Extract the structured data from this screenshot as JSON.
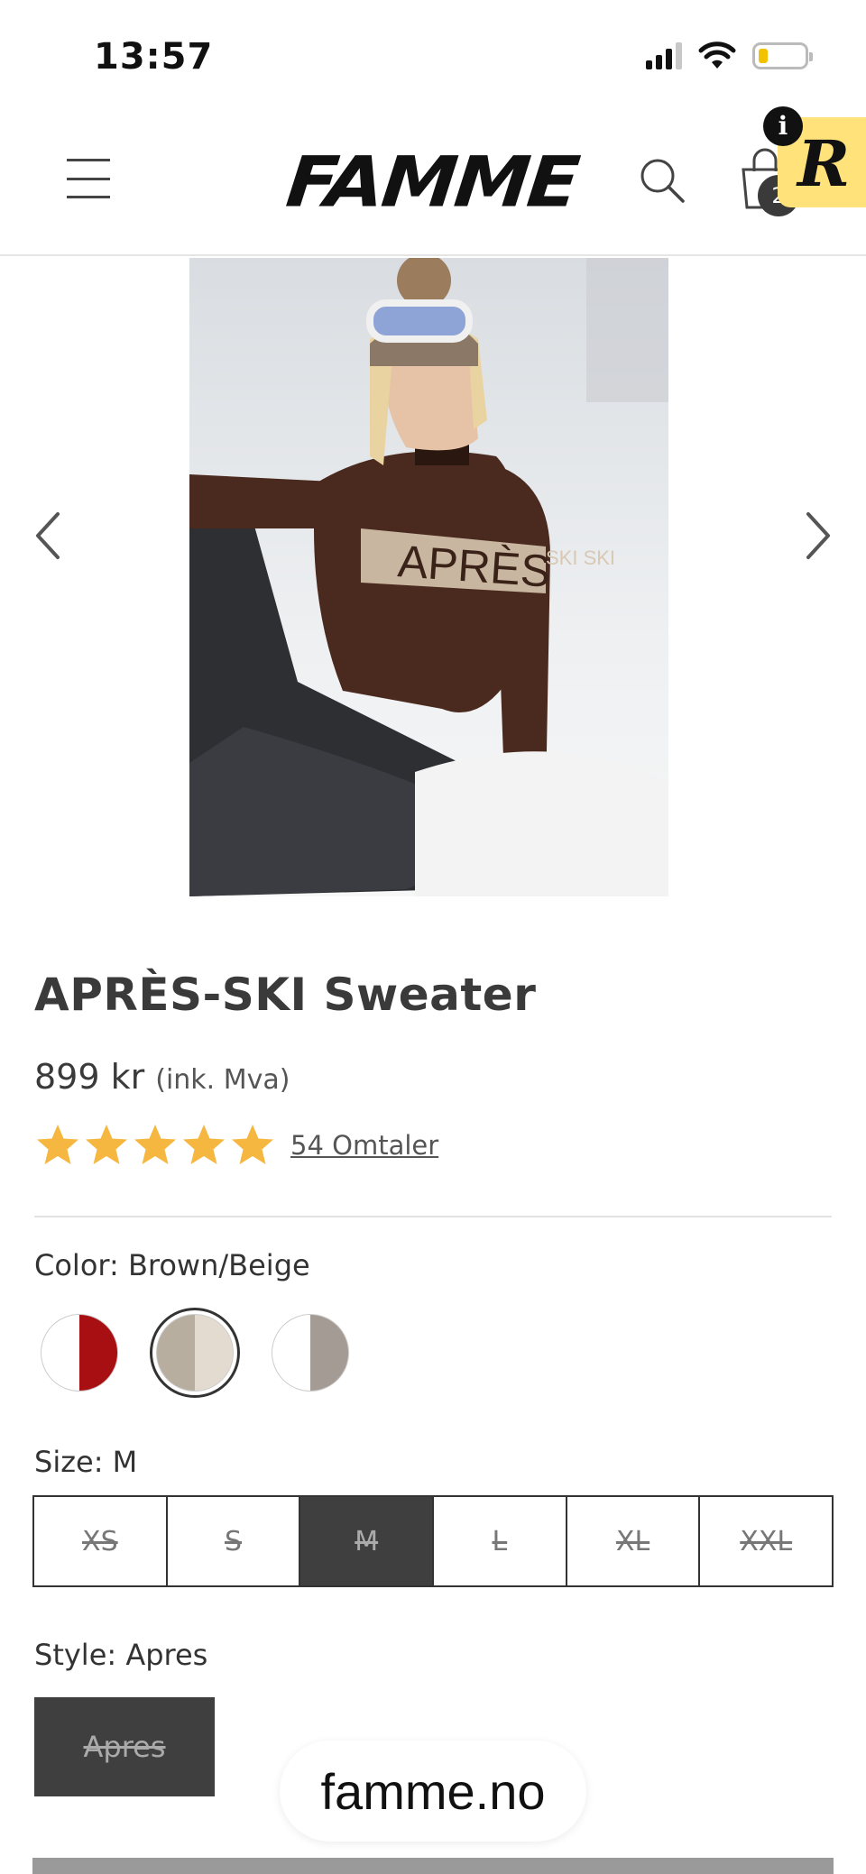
{
  "status_bar": {
    "time": "13:57"
  },
  "header": {
    "logo": "FAMME",
    "cart_count": "2",
    "reviewer_badge_letter": "R",
    "reviewer_info_glyph": "i"
  },
  "product": {
    "title": "APRÈS-SKI Sweater",
    "price": "899 kr",
    "price_note": "(ink. Mva)",
    "rating": 5,
    "rating_max": 5,
    "reviews_label": "54 Omtaler",
    "image_text": "APRÈS",
    "sleeve_text": "SKI SKI"
  },
  "color": {
    "label": "Color: Brown/Beige",
    "swatches": [
      {
        "name": "red-white",
        "left": "#ffffff",
        "right": "#a80f12",
        "selected": false
      },
      {
        "name": "brown-beige",
        "left": "#b8ae9f",
        "right": "#e4dbd0",
        "selected": true
      },
      {
        "name": "grey-white",
        "left": "#ffffff",
        "right": "#a49b95",
        "selected": false
      }
    ]
  },
  "size": {
    "label": "Size: M",
    "options": [
      "XS",
      "S",
      "M",
      "L",
      "XL",
      "XXL"
    ],
    "selected": "M"
  },
  "style": {
    "label": "Style: Apres",
    "option": "Apres"
  },
  "site": {
    "domain": "famme.no"
  },
  "colors": {
    "accent_dark": "#3f3f3f",
    "star": "#f5b740",
    "badge_yellow": "#ffe27a"
  }
}
